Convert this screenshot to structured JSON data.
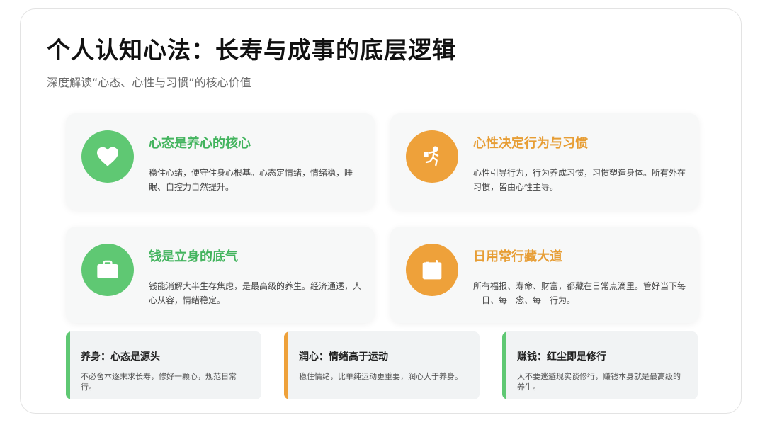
{
  "header": {
    "title": "个人认知心法：长寿与成事的底层逻辑",
    "subtitle": "深度解读“心态、心性与习惯”的核心价值"
  },
  "cards": [
    {
      "icon": "heart-icon",
      "title": "心态是养心的核心",
      "body": "稳住心绪，便守住身心根基。心态定情绪，情绪稳，睡眠、自控力自然提升。"
    },
    {
      "icon": "running-person-icon",
      "title": "心性决定行为与习惯",
      "body": "心性引导行为，行为养成习惯，习惯塑造身体。所有外在习惯，皆由心性主导。"
    },
    {
      "icon": "wallet-icon",
      "title": "钱是立身的底气",
      "body": "钱能消解大半生存焦虑，是最高级的养生。经济通透，人心从容，情绪稳定。"
    },
    {
      "icon": "calendar-icon",
      "title": "日用常行藏大道",
      "body": "所有福报、寿命、财富，都藏在日常点滴里。管好当下每一日、每一念、每一行为。"
    }
  ],
  "notes": [
    {
      "title": "养身：心态是源头",
      "body": "不必舍本逐末求长寿，修好一颗心，规范日常行。"
    },
    {
      "title": "润心：情绪高于运动",
      "body": "稳住情绪，比单纯运动更重要，润心大于养身。"
    },
    {
      "title": "赚钱：红尘即是修行",
      "body": "人不要逃避现实谈修行，赚钱本身就是最高级的养生。"
    }
  ],
  "colors": {
    "green": "#5fc873",
    "orange": "#eea13a",
    "green_text": "#43b45e",
    "orange_text": "#e79d34"
  }
}
